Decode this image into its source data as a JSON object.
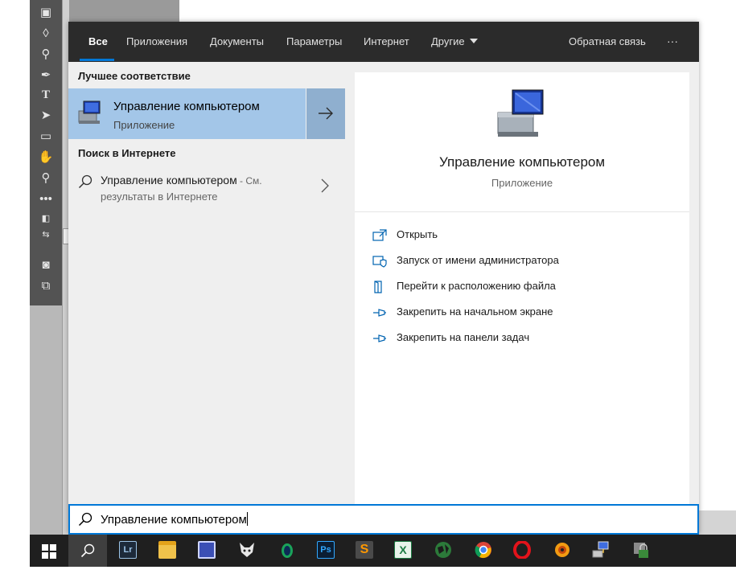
{
  "tabs": [
    "Все",
    "Приложения",
    "Документы",
    "Параметры",
    "Интернет",
    "Другие"
  ],
  "feedback": "Обратная связь",
  "more": "···",
  "best_match": {
    "section": "Лучшее соответствие",
    "title": "Управление компьютером",
    "subtitle": "Приложение"
  },
  "web_search": {
    "section": "Поиск в Интернете",
    "title": "Управление компьютером",
    "suffix": " - См.",
    "subtitle": "результаты в Интернете"
  },
  "preview": {
    "title": "Управление компьютером",
    "subtitle": "Приложение",
    "actions": [
      "Открыть",
      "Запуск от имени администратора",
      "Перейти к расположению файла",
      "Закрепить на начальном экране",
      "Закрепить на панели задач"
    ]
  },
  "search": {
    "value": "Управление компьютером"
  },
  "taskbar": {
    "apps": [
      "windows-start",
      "search",
      "lightroom",
      "file-explorer",
      "save-disk",
      "foobar",
      "app-green-drop",
      "photoshop",
      "sublime-text",
      "excel",
      "app-globe",
      "chrome",
      "opera",
      "xnview",
      "network-app",
      "lock-app"
    ],
    "lightroom_label": "Lr",
    "photoshop_label": "Ps"
  },
  "colors": {
    "accent": "#0078d7",
    "selection": "#a3c6e8",
    "tab_bar": "#2b2b2b"
  }
}
